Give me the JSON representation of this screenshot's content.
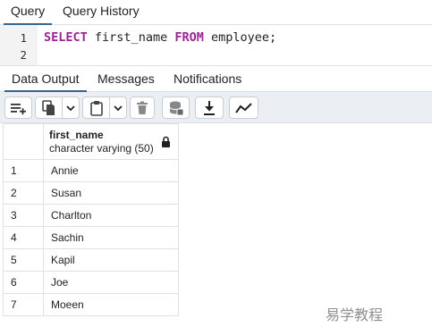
{
  "top_tabs": [
    {
      "label": "Query",
      "active": true
    },
    {
      "label": "Query History",
      "active": false
    }
  ],
  "editor": {
    "line_numbers": [
      "1",
      "2"
    ],
    "keyword_select": "SELECT",
    "column": "first_name",
    "keyword_from": "FROM",
    "table": "employee;"
  },
  "output_tabs": [
    {
      "label": "Data Output",
      "active": true
    },
    {
      "label": "Messages",
      "active": false
    },
    {
      "label": "Notifications",
      "active": false
    }
  ],
  "toolbar": {
    "icons": [
      "add-row-icon",
      "copy-icon",
      "chevron-down-icon",
      "paste-icon",
      "chevron-down-icon",
      "trash-icon",
      "save-data-icon",
      "download-icon",
      "graph-icon"
    ]
  },
  "grid": {
    "column": {
      "name": "first_name",
      "type": "character varying (50)",
      "icon": "lock-icon"
    },
    "rows": [
      {
        "num": "1",
        "value": "Annie"
      },
      {
        "num": "2",
        "value": "Susan"
      },
      {
        "num": "3",
        "value": "Charlton"
      },
      {
        "num": "4",
        "value": "Sachin"
      },
      {
        "num": "5",
        "value": "Kapil"
      },
      {
        "num": "6",
        "value": "Joe"
      },
      {
        "num": "7",
        "value": "Moeen"
      }
    ]
  },
  "watermark": "易学教程",
  "colors": {
    "accent": "#326690",
    "keyword": "#9b2393",
    "toolbar_bg": "#ebeef3",
    "border": "#dee2e6"
  }
}
